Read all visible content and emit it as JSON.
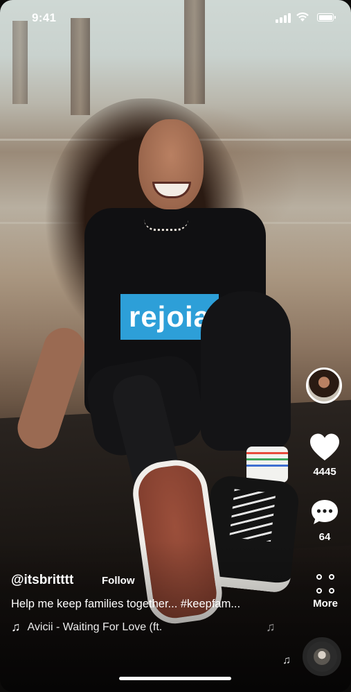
{
  "status_bar": {
    "time": "9:41"
  },
  "video": {
    "shirt_text": "rejoia"
  },
  "actions": {
    "like_count": "4445",
    "comment_count": "64",
    "more_label": "More"
  },
  "post": {
    "username": "@itsbritttt",
    "follow_label": "Follow",
    "caption": "Help me keep families together... #keepfam...",
    "music_note": "♫",
    "music_title": "Avicii - Waiting For Love (ft."
  },
  "icons": {
    "like": "heart-icon",
    "comment": "comment-icon",
    "more": "more-dots-icon",
    "music": "music-note-icon"
  },
  "colors": {
    "shirt_logo": "#2d9fd8",
    "text": "#ffffff"
  }
}
